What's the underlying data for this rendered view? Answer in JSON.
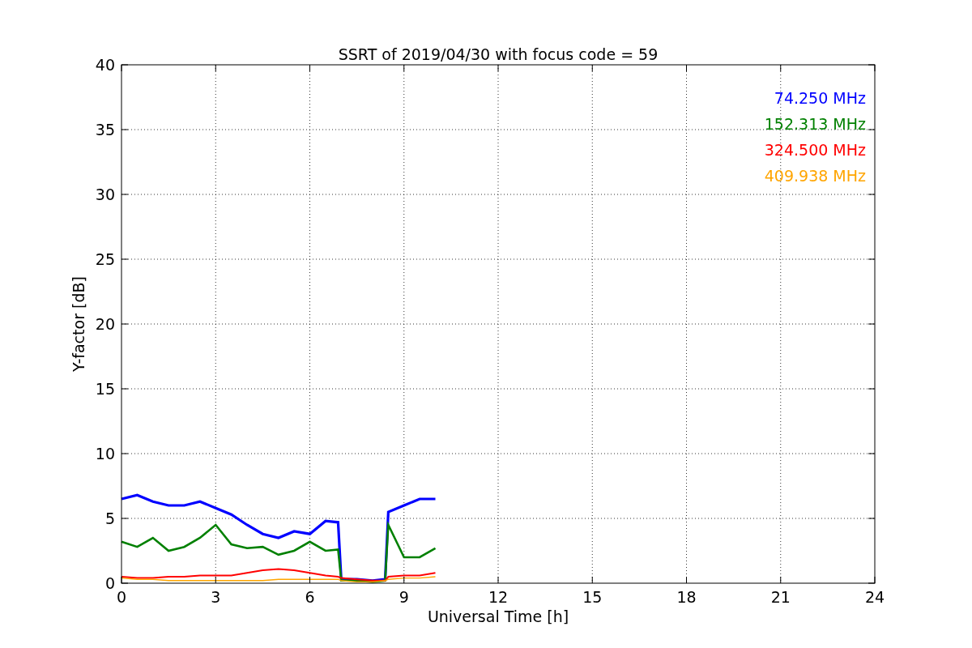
{
  "chart_data": {
    "type": "line",
    "title": "SSRT of 2019/04/30 with focus code = 59",
    "xlabel": "Universal Time [h]",
    "ylabel": "Y-factor [dB]",
    "x": [
      0,
      0.5,
      1,
      1.5,
      2,
      2.5,
      3,
      3.5,
      4,
      4.5,
      5,
      5.5,
      6,
      6.5,
      6.9,
      7,
      7.5,
      8,
      8.4,
      8.5,
      9,
      9.5,
      10
    ],
    "series": [
      {
        "name": "74.250 MHz",
        "color": "#0000ff",
        "values": [
          6.5,
          6.8,
          6.3,
          6.0,
          6.0,
          6.3,
          5.8,
          5.3,
          4.5,
          3.8,
          3.5,
          4.0,
          3.8,
          4.8,
          4.7,
          0.3,
          0.3,
          0.2,
          0.3,
          5.5,
          6.0,
          6.5,
          6.5
        ]
      },
      {
        "name": "152.313 MHz",
        "color": "#008000",
        "values": [
          3.2,
          2.8,
          3.5,
          2.5,
          2.8,
          3.5,
          4.5,
          3.0,
          2.7,
          2.8,
          2.2,
          2.5,
          3.2,
          2.5,
          2.6,
          0.2,
          0.2,
          0.1,
          0.2,
          4.5,
          2.0,
          2.0,
          2.7
        ]
      },
      {
        "name": "324.500 MHz",
        "color": "#ff0000",
        "values": [
          0.5,
          0.4,
          0.4,
          0.5,
          0.5,
          0.6,
          0.6,
          0.6,
          0.8,
          1.0,
          1.1,
          1.0,
          0.8,
          0.6,
          0.5,
          0.4,
          0.3,
          0.2,
          0.2,
          0.5,
          0.6,
          0.6,
          0.8
        ]
      },
      {
        "name": "409.938 MHz",
        "color": "#ffa500",
        "values": [
          0.4,
          0.3,
          0.3,
          0.2,
          0.2,
          0.2,
          0.2,
          0.2,
          0.2,
          0.2,
          0.3,
          0.3,
          0.3,
          0.3,
          0.3,
          0.2,
          0.1,
          0.1,
          0.2,
          0.3,
          0.4,
          0.4,
          0.5
        ]
      }
    ],
    "xlim": [
      0,
      24
    ],
    "ylim": [
      0,
      40
    ],
    "xticks": [
      0,
      3,
      6,
      9,
      12,
      15,
      18,
      21,
      24
    ],
    "yticks": [
      0,
      5,
      10,
      15,
      20,
      25,
      30,
      35,
      40
    ],
    "grid": true
  }
}
